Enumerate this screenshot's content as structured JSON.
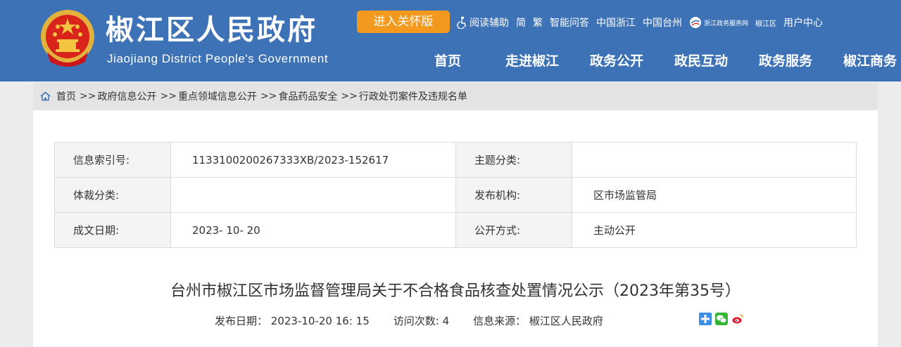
{
  "header": {
    "title": "椒江区人民政府",
    "subtitle": "Jiaojiang District People's Government",
    "care_button": "进入关怀版",
    "links": {
      "reading_aid": "阅读辅助",
      "simplified": "简",
      "traditional": "繁",
      "smart_qa": "智能问答",
      "zhejiang": "中国浙江",
      "taizhou": "中国台州",
      "service_logo": "浙江政务服务网",
      "service_region": "椒江区",
      "user_center": "用户中心"
    },
    "nav": [
      "首页",
      "走进椒江",
      "政务公开",
      "政民互动",
      "政务服务",
      "椒江商务"
    ],
    "colors": {
      "header_bg": "#3d73b6",
      "care_button_bg": "#f39a1e"
    }
  },
  "breadcrumb": {
    "items": [
      "首页",
      "政府信息公开",
      "重点领域信息公开",
      "食品药品安全",
      "行政处罚案件及违规名单"
    ],
    "separator": ">>"
  },
  "info": {
    "index_no_label": "信息索引号:",
    "index_no_value": "1133100200267333XB/2023-152617",
    "topic_label": "主题分类:",
    "topic_value": "",
    "genre_label": "体裁分类:",
    "genre_value": "",
    "publisher_label": "发布机构:",
    "publisher_value": "区市场监管局",
    "date_label": "成文日期:",
    "date_value": "2023- 10- 20",
    "open_label": "公开方式:",
    "open_value": "主动公开"
  },
  "article": {
    "title": "台州市椒江区市场监督管理局关于不合格食品核查处置情况公示（2023年第35号）",
    "publish_date_label": "发布日期：",
    "publish_date": "2023-10-20 16: 15",
    "visits_label": "访问次数:",
    "visits": "4",
    "source_label": "信息来源：",
    "source": "椒江区人民政府"
  }
}
